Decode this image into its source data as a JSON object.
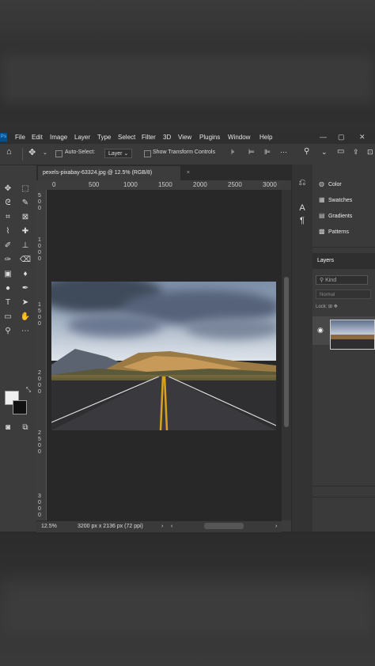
{
  "menu": {
    "logo": "Ps",
    "items": [
      "File",
      "Edit",
      "Image",
      "Layer",
      "Type",
      "Select",
      "Filter",
      "3D",
      "View",
      "Plugins",
      "Window",
      "Help"
    ]
  },
  "options": {
    "auto_select": "Auto-Select:",
    "layer_dropdown": "Layer",
    "show_transform": "Show Transform Controls"
  },
  "document": {
    "tab_title": "pexels-pixabay-63324.jpg @ 12.5% (RGB/8)",
    "close": "×"
  },
  "ruler": {
    "h_ticks": [
      "0",
      "500",
      "1000",
      "1500",
      "2000",
      "2500",
      "3000"
    ],
    "v_ticks": [
      "5",
      "0",
      "0",
      "1",
      "0",
      "0",
      "0",
      "1",
      "5",
      "0",
      "0",
      "2",
      "0",
      "0",
      "0",
      "2",
      "5",
      "0",
      "0",
      "3",
      "0",
      "0",
      "0"
    ]
  },
  "status": {
    "zoom": "12.5%",
    "size": "3200 px x 2136 px (72 ppi)",
    "arrow": "›"
  },
  "right_panel": {
    "items": [
      {
        "label": "Color",
        "icon": "color-icon"
      },
      {
        "label": "Swatches",
        "icon": "swatches-icon"
      },
      {
        "label": "Gradients",
        "icon": "gradients-icon"
      },
      {
        "label": "Patterns",
        "icon": "patterns-icon"
      }
    ],
    "layers_tab": "Layers",
    "kind_placeholder": "Kind",
    "blend_mode": "Normal",
    "lock_label": "Lock:"
  },
  "colors": {
    "accent": "#31a8ff",
    "panel_bg": "#3a3a3a",
    "canvas_bg": "#282828"
  }
}
